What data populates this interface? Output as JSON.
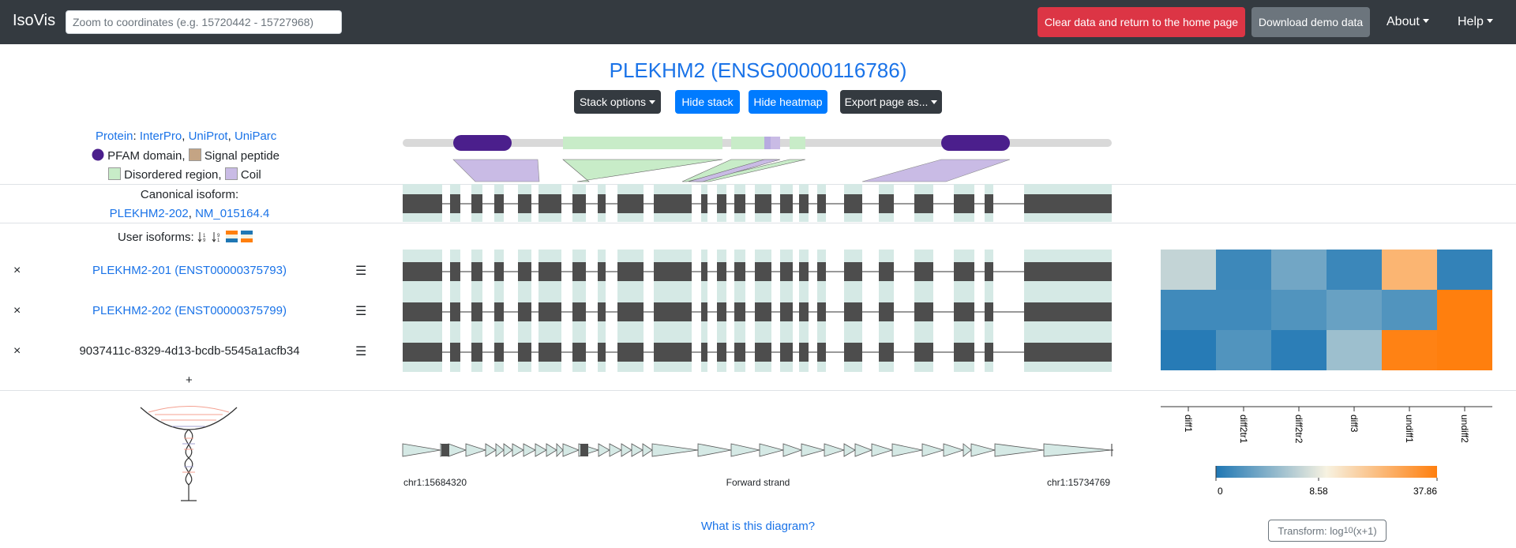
{
  "navbar": {
    "brand": "IsoVis",
    "search_placeholder": "Zoom to coordinates (e.g. 15720442 - 15727968)",
    "clear_label": "Clear data and return to the home page",
    "demo_label": "Download demo data",
    "about_label": "About",
    "help_label": "Help"
  },
  "gene_title": "PLEKHM2 (ENSG00000116786)",
  "toolbar": {
    "stack_options": "Stack options",
    "hide_stack": "Hide stack",
    "hide_heatmap": "Hide heatmap",
    "export_page": "Export page as..."
  },
  "protein": {
    "label": "Protein",
    "sep": ":",
    "links": [
      "InterPro",
      "UniProt",
      "UniParc"
    ],
    "legend": [
      "PFAM domain,",
      "Signal peptide",
      "Disordered region,",
      "Coil"
    ],
    "colors": {
      "pfam": "#4b1f8c",
      "signal": "#c4a484",
      "disordered": "#c8ecc8",
      "coil": "#c9bbe5"
    }
  },
  "canonical": {
    "label": "Canonical isoform:",
    "transcript": "PLEKHM2-202",
    "refseq": "NM_015164.4"
  },
  "user_isoforms": {
    "label": "User isoforms:",
    "rows": [
      {
        "remove": "×",
        "name": "PLEKHM2-201 (ENST00000375793)",
        "menu": "☰"
      },
      {
        "remove": "×",
        "name": "PLEKHM2-202 (ENST00000375799)",
        "menu": "☰"
      },
      {
        "remove": "×",
        "name": "9037411c-8329-4d13-bcdb-5545a1acfb34",
        "menu": "☰"
      }
    ],
    "add": "+"
  },
  "heatmap": {
    "samples": [
      "diff1",
      "diff2tr1",
      "diff2tr2",
      "diff3",
      "undiff1",
      "undiff2"
    ],
    "values": [
      [
        6.5,
        1.2,
        3.3,
        1.1,
        24.0,
        0.8
      ],
      [
        1.3,
        1.3,
        2.0,
        2.9,
        2.0,
        37.86
      ],
      [
        0.3,
        2.0,
        0.5,
        5.0,
        37.0,
        37.86
      ]
    ],
    "scale_min": "0",
    "scale_mid": "8.58",
    "scale_max": "37.86",
    "transform_prefix": "Transform: log",
    "transform_sub": "10",
    "transform_suffix": "(x+1)",
    "colors": {
      "low": "#1f77b4",
      "mid": "#f7f2e1",
      "high": "#ff7f0e"
    }
  },
  "genome": {
    "start": "chr1:15684320",
    "strand": "Forward strand",
    "end": "chr1:15734769"
  },
  "help_link": "What is this diagram?"
}
